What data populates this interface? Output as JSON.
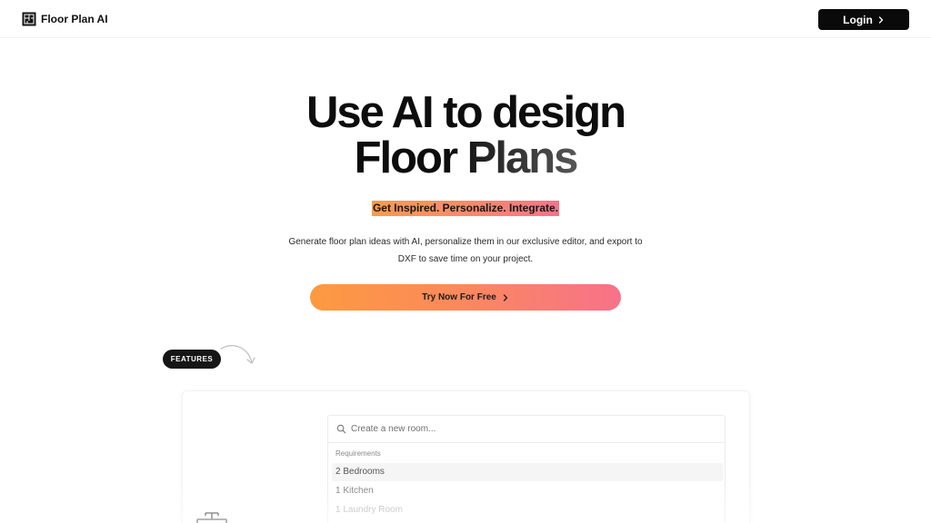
{
  "header": {
    "logo_text": "Floor Plan AI",
    "login_label": "Login"
  },
  "hero": {
    "title_line1": "Use AI to design",
    "title_line2": "Floor Plans",
    "tagline": "Get Inspired. Personalize. Integrate.",
    "description": "Generate floor plan ideas with AI, personalize them in our exclusive editor, and export to DXF to save time on your project.",
    "cta_label": "Try Now For Free"
  },
  "features": {
    "badge": "FEATURES",
    "search_placeholder": "Create a new room...",
    "section_label": "Requirements",
    "requirements": [
      "2 Bedrooms",
      "1 Kitchen",
      "1 Laundry Room"
    ]
  },
  "icons": {
    "logo": "floor-plan-logo-icon",
    "login": "chevron-right-icon",
    "cta": "chevron-right-icon",
    "search": "search-icon",
    "features_arrow": "curved-arrow-icon",
    "card": "floor-plan-outline-icon"
  },
  "colors": {
    "login_button": "#0a0a0a",
    "gradient_start": "#fd9a40",
    "gradient_end": "#f7728a",
    "badge": "#161616"
  }
}
